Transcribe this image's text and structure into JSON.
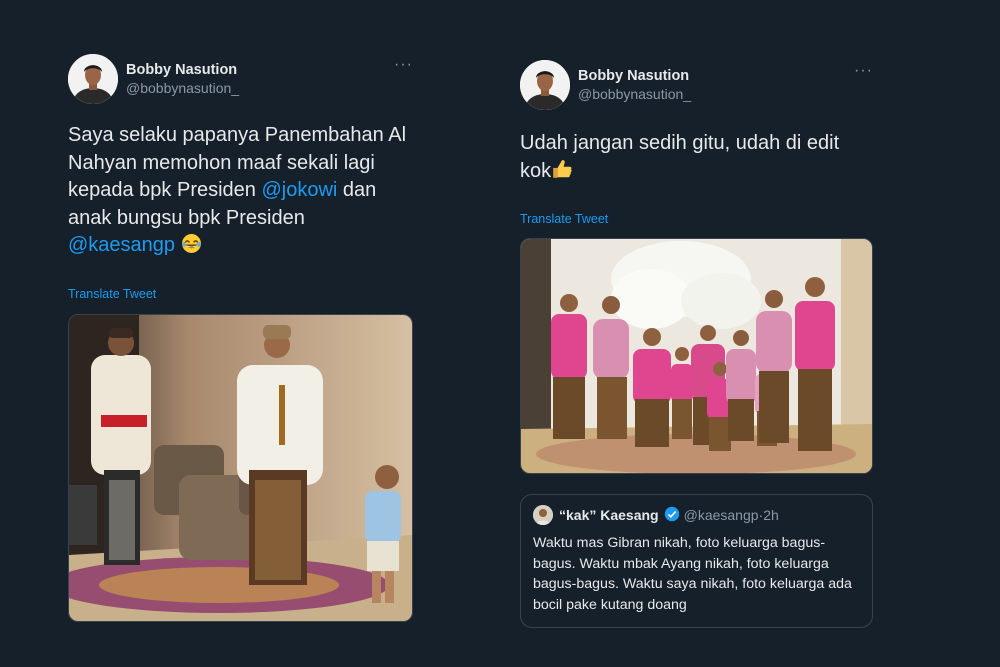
{
  "left_tweet": {
    "display_name": "Bobby Nasution",
    "handle": "@bobbynasution_",
    "more_icon": "more-horizontal-icon",
    "text_parts": {
      "p1": "Saya selaku papanya Panembahan Al Nahyan memohon maaf sekali lagi kepada bpk Presiden ",
      "mention1": "@jokowi",
      "p2": " dan anak bungsu bpk Presiden ",
      "mention2": "@kaesangp",
      "p3": " "
    },
    "emoji": "face-with-tears-of-joy",
    "translate_label": "Translate Tweet"
  },
  "right_tweet": {
    "display_name": "Bobby Nasution",
    "handle": "@bobbynasution_",
    "more_icon": "more-horizontal-icon",
    "text": "Udah jangan sedih gitu, udah di edit kok",
    "emoji": "thumbs-up",
    "translate_label": "Translate Tweet",
    "quote": {
      "display_name": "“kak” Kaesang",
      "handle": "@kaesangp",
      "separator": "·",
      "time": "2h",
      "text": "Waktu mas Gibran nikah, foto keluarga bagus-bagus. Waktu mbak Ayang nikah, foto keluarga bagus-bagus. Waktu saya nikah, foto keluarga ada bocil pake kutang doang"
    }
  },
  "colors": {
    "background": "#15202b",
    "text": "#e7e9ea",
    "secondary": "#8b98a5",
    "link": "#1d9bf0",
    "border": "#38444d",
    "family_outfit": "#e0458f"
  }
}
